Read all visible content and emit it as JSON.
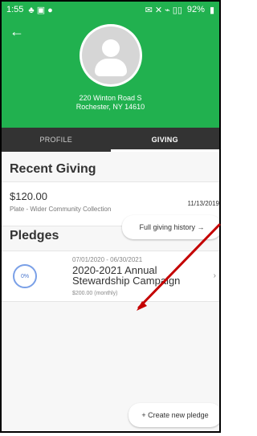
{
  "status_bar": {
    "time": "1:55",
    "icons_left": "♣ ▣ ●",
    "icons_right": "✉ ✕ ⌁ ▯▯",
    "battery": "92%"
  },
  "header": {
    "address_line1": "220 Winton Road S",
    "address_line2": "Rochester, NY 14610"
  },
  "tabs": [
    {
      "label": "PROFILE"
    },
    {
      "label": "GIVING"
    }
  ],
  "recent_giving": {
    "title": "Recent Giving",
    "item": {
      "amount": "$120.00",
      "description": "Plate - Wider Community Collection",
      "date": "11/13/2019"
    },
    "history_button": "Full giving history →"
  },
  "pledges": {
    "title": "Pledges",
    "item": {
      "date_range": "07/01/2020 - 06/30/2021",
      "name": "2020-2021 Annual Stewardship Campaign",
      "rate": "$200.00 (monthly)",
      "progress_label": "0%",
      "progress_value": 0
    },
    "create_button": "+ Create new pledge"
  },
  "colors": {
    "brand_green": "#21b14f",
    "tab_bar": "#333333",
    "annotation_arrow": "#c40000",
    "progress_ring": "#7aa0e7"
  }
}
